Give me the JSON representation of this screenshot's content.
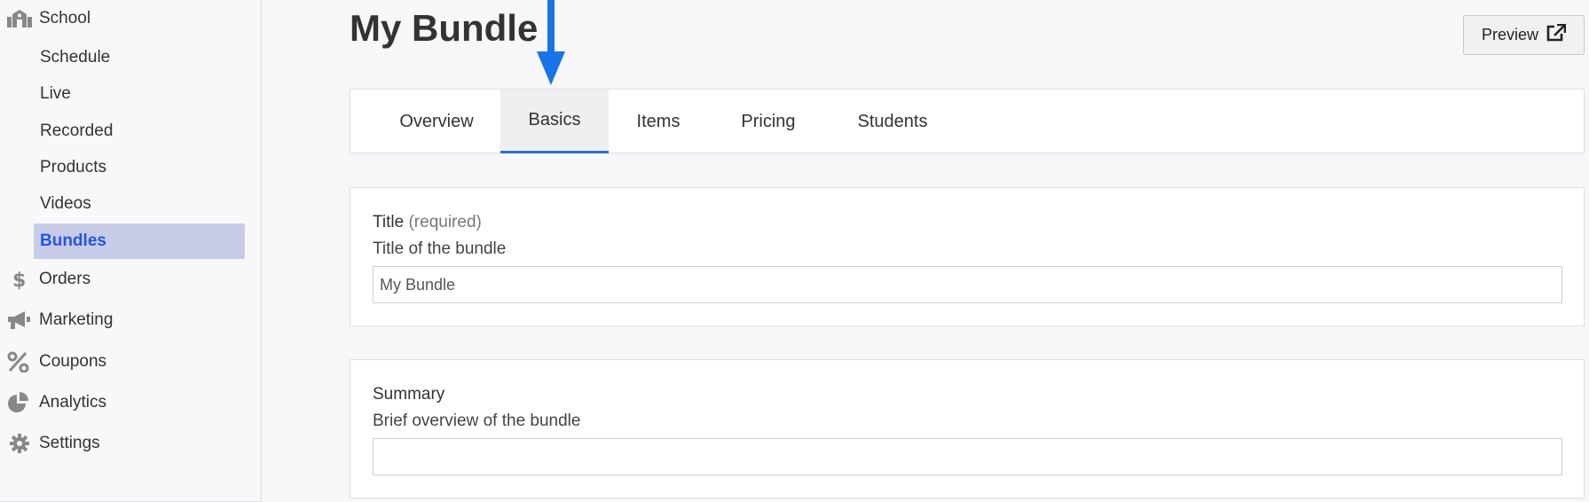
{
  "sidebar": {
    "school": {
      "label": "School",
      "icon": "school-icon"
    },
    "subitems": [
      {
        "label": "Schedule"
      },
      {
        "label": "Live"
      },
      {
        "label": "Recorded"
      },
      {
        "label": "Products"
      },
      {
        "label": "Videos"
      },
      {
        "label": "Bundles",
        "active": true
      }
    ],
    "items": [
      {
        "label": "Orders",
        "icon": "dollar-icon"
      },
      {
        "label": "Marketing",
        "icon": "megaphone-icon"
      },
      {
        "label": "Coupons",
        "icon": "percent-icon"
      },
      {
        "label": "Analytics",
        "icon": "pie-chart-icon"
      },
      {
        "label": "Settings",
        "icon": "gear-icon"
      }
    ]
  },
  "header": {
    "title": "My Bundle",
    "preview_label": "Preview",
    "preview_icon": "external-link-icon"
  },
  "tabs": [
    {
      "label": "Overview"
    },
    {
      "label": "Basics",
      "active": true
    },
    {
      "label": "Items"
    },
    {
      "label": "Pricing"
    },
    {
      "label": "Students"
    }
  ],
  "form": {
    "title_field": {
      "label": "Title",
      "required_note": "(required)",
      "help": "Title of the bundle",
      "value": "My Bundle"
    },
    "summary_field": {
      "label": "Summary",
      "help": "Brief overview of the bundle",
      "value": ""
    }
  },
  "colors": {
    "accent": "#2357e0",
    "active_nav_bg": "#c8cbe8",
    "tab_underline": "#2f6fd0",
    "annotation_arrow": "#1a73e8"
  }
}
